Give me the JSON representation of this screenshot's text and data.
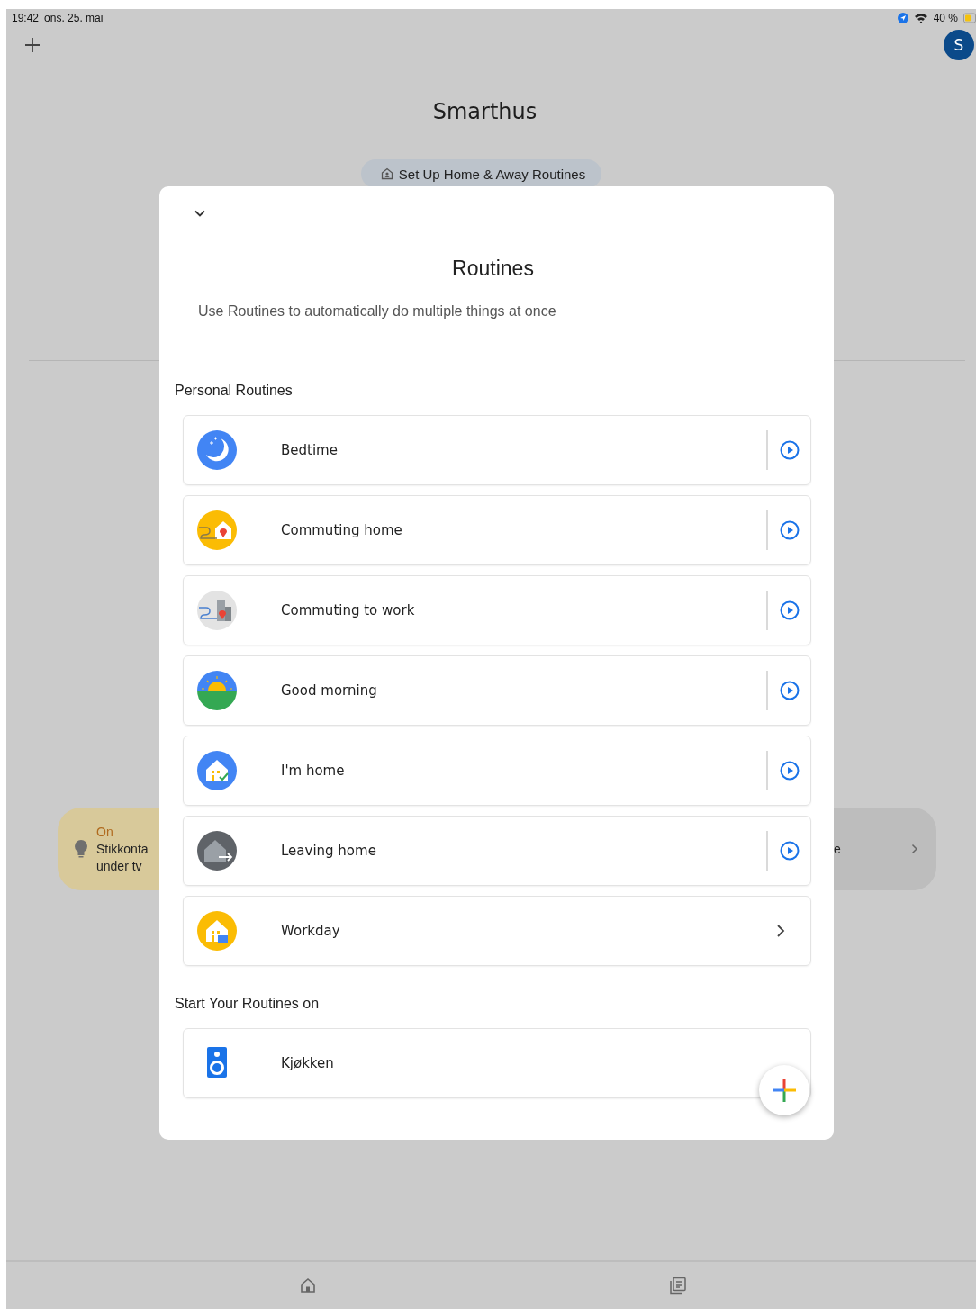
{
  "status_bar": {
    "time": "19:42",
    "date": "ons. 25. mai",
    "battery": "40 %"
  },
  "header": {
    "avatar": "S",
    "title": "Smarthus",
    "chip": "Set Up Home & Away Routines"
  },
  "devices": [
    {
      "status": "On",
      "name_lines": [
        "Stikkonta",
        "under tv"
      ],
      "on": true
    },
    {
      "name_lines": [
        "e"
      ],
      "on": false
    }
  ],
  "sheet": {
    "title": "Routines",
    "subtitle": "Use Routines to automatically do multiple things at once",
    "personal_heading": "Personal Routines",
    "routines": [
      {
        "label": "Bedtime",
        "kind": "play"
      },
      {
        "label": "Commuting home",
        "kind": "play"
      },
      {
        "label": "Commuting to work",
        "kind": "play"
      },
      {
        "label": "Good morning",
        "kind": "play"
      },
      {
        "label": "I'm home",
        "kind": "play"
      },
      {
        "label": "Leaving home",
        "kind": "play"
      },
      {
        "label": "Workday",
        "kind": "open"
      }
    ],
    "start_heading": "Start Your Routines on",
    "speakers": [
      {
        "label": "Kjøkken"
      }
    ]
  }
}
